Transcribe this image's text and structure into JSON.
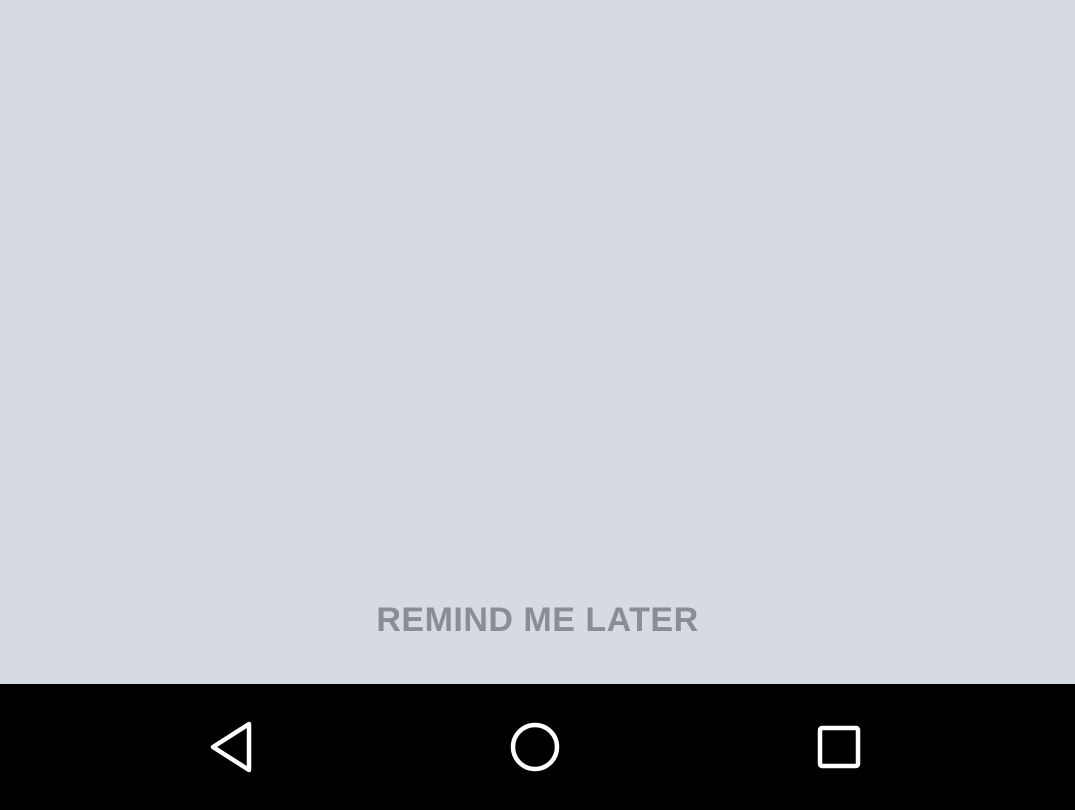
{
  "main": {
    "remind_button_label": "REMIND ME LATER"
  },
  "navigation_bar": {
    "buttons": [
      {
        "icon": "back-icon"
      },
      {
        "icon": "home-icon"
      },
      {
        "icon": "recent-apps-icon"
      }
    ]
  },
  "colors": {
    "background": "#d6dae1",
    "button_text": "#8a8e93",
    "nav_bar": "#000000",
    "nav_icon": "#ffffff"
  }
}
